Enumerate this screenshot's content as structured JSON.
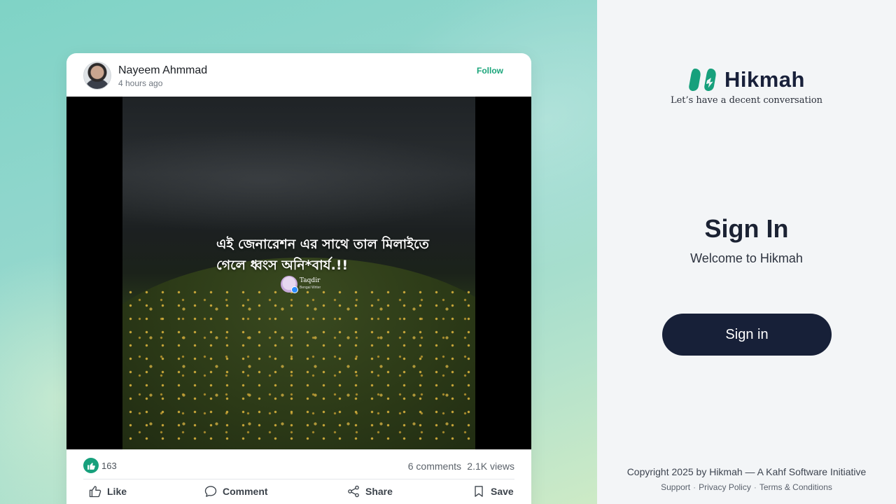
{
  "post": {
    "author_name": "Nayeem Ahmmad",
    "timestamp": "4 hours ago",
    "follow_label": "Follow",
    "media": {
      "caption_line1": "এই জেনারেশন এর সাথে তাল মিলাইতে",
      "caption_line2": "গেলে ধ্বংস অনি*বার্য.!!",
      "watermark_name": "Taqdir",
      "watermark_sub": "Bengal Writer"
    },
    "stats": {
      "likes": "163",
      "comments": "6 comments",
      "views": "2.1K views"
    },
    "actions": {
      "like": "Like",
      "comment": "Comment",
      "share": "Share",
      "save": "Save"
    }
  },
  "brand": {
    "name": "Hikmah",
    "tagline": "Let’s have a decent conversation",
    "accent_color": "#17a07c",
    "logo_icon": "hikmah-logo-icon"
  },
  "signin": {
    "title": "Sign In",
    "subtitle": "Welcome to Hikmah",
    "button_label": "Sign in",
    "button_color": "#172038"
  },
  "footer": {
    "copyright": "Copyright 2025 by Hikmah — A Kahf Software Initiative",
    "links": {
      "support": "Support",
      "privacy": "Privacy Policy",
      "terms": "Terms & Conditions"
    }
  }
}
